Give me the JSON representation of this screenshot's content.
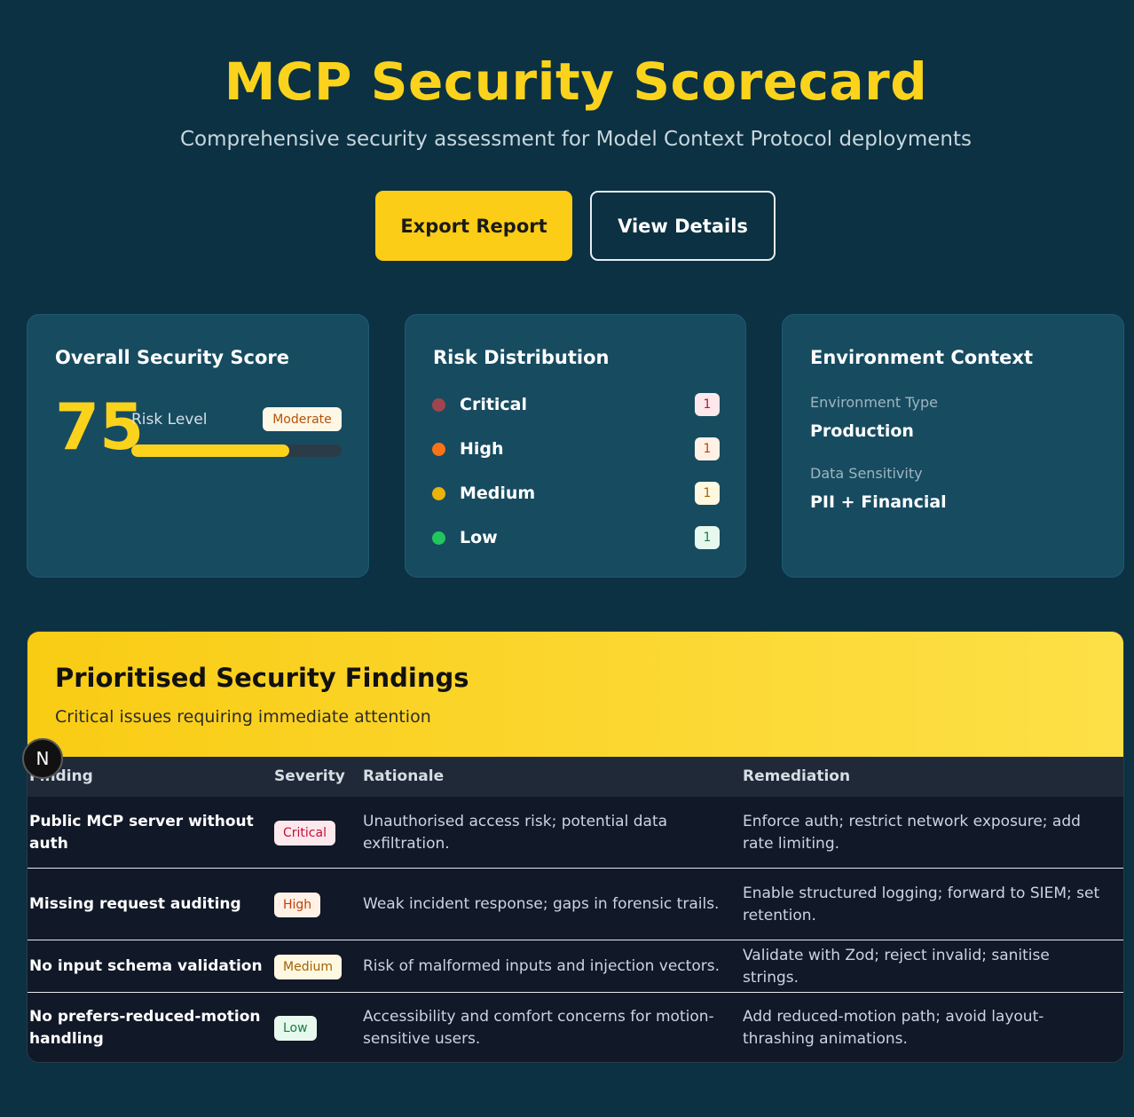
{
  "header": {
    "title": "MCP Security Scorecard",
    "subtitle": "Comprehensive security assessment for Model Context Protocol deployments",
    "export_label": "Export Report",
    "details_label": "View Details"
  },
  "score_card": {
    "title": "Overall Security Score",
    "score": "75",
    "risk_label": "Risk Level",
    "risk_value": "Moderate",
    "progress_fraction": 0.75
  },
  "distribution": {
    "title": "Risk Distribution",
    "items": [
      {
        "label": "Critical",
        "count": "1",
        "dot": "#a0454f",
        "badge_bg": "#fde8ec",
        "badge_fg": "#be123c"
      },
      {
        "label": "High",
        "count": "1",
        "dot": "#f97316",
        "badge_bg": "#fff1e6",
        "badge_fg": "#c2410c"
      },
      {
        "label": "Medium",
        "count": "1",
        "dot": "#eab308",
        "badge_bg": "#fff8e1",
        "badge_fg": "#a16207"
      },
      {
        "label": "Low",
        "count": "1",
        "dot": "#22c55e",
        "badge_bg": "#e7f8ef",
        "badge_fg": "#15803d"
      }
    ]
  },
  "environment": {
    "title": "Environment Context",
    "type_label": "Environment Type",
    "type_value": "Production",
    "sensitivity_label": "Data Sensitivity",
    "sensitivity_value": "PII + Financial"
  },
  "findings": {
    "title": "Prioritised Security Findings",
    "subtitle": "Critical issues requiring immediate attention",
    "columns": [
      "Finding",
      "Severity",
      "Rationale",
      "Remediation"
    ],
    "rows": [
      {
        "finding": "Public MCP server without auth",
        "severity": "Critical",
        "rationale": "Unauthorised access risk; potential data exfiltration.",
        "remediation": "Enforce auth; restrict network exposure; add rate limiting."
      },
      {
        "finding": "Missing request auditing",
        "severity": "High",
        "rationale": "Weak incident response; gaps in forensic trails.",
        "remediation": "Enable structured logging; forward to SIEM; set retention."
      },
      {
        "finding": "No input schema validation",
        "severity": "Medium",
        "rationale": "Risk of malformed inputs and injection vectors.",
        "remediation": "Validate with Zod; reject invalid; sanitise strings."
      },
      {
        "finding": "No prefers-reduced-motion handling",
        "severity": "Low",
        "rationale": "Accessibility and comfort concerns for motion-sensitive users.",
        "remediation": "Add reduced-motion path; avoid layout-thrashing animations."
      }
    ]
  },
  "overlay": {
    "badge_letter": "N"
  },
  "colors": {
    "accent": "#fbd31c",
    "background": "#0b3142",
    "card": "#174b60"
  }
}
